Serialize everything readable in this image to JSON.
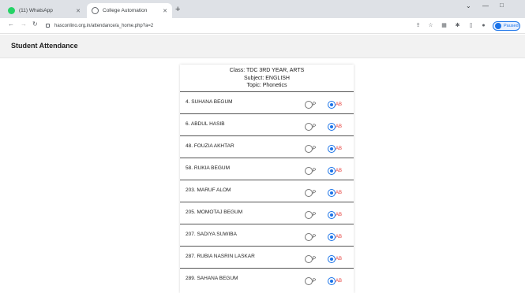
{
  "browser": {
    "tabs": [
      {
        "title": "(11) WhatsApp",
        "active": false,
        "icon": "whatsapp-icon"
      },
      {
        "title": "College Automation",
        "active": true,
        "icon": "globe-icon"
      }
    ],
    "new_tab_label": "+",
    "url": "hasconlino.org.in/attendance/a_home.php?a=2",
    "profile_label": "Paused",
    "colors": {
      "accent": "#1a73e8",
      "tabbar": "#dee1e6"
    }
  },
  "page": {
    "title": "Student Attendance",
    "class_line": "Class: TDC 3RD YEAR, ARTS",
    "subject_line": "Subject: ENGLISH",
    "topic_line": "Topic: Phonetics",
    "present_label": "P",
    "absent_label": "AB",
    "students": [
      {
        "name": "4. SUHANA BEGUM",
        "status": "AB"
      },
      {
        "name": "6. ABDUL HASIB",
        "status": "AB"
      },
      {
        "name": "48. FOUZIA AKHTAR",
        "status": "AB"
      },
      {
        "name": "58. RUKIA BEGUM",
        "status": "AB"
      },
      {
        "name": "203. MARUF ALOM",
        "status": "AB"
      },
      {
        "name": "205. MOMOTAJ BEGUM",
        "status": "AB"
      },
      {
        "name": "207. SADIYA SUWIBA",
        "status": "AB"
      },
      {
        "name": "287. RUBIA NASRIN LASKAR",
        "status": "AB"
      },
      {
        "name": "289. SAHANA BEGUM",
        "status": "AB"
      }
    ]
  }
}
